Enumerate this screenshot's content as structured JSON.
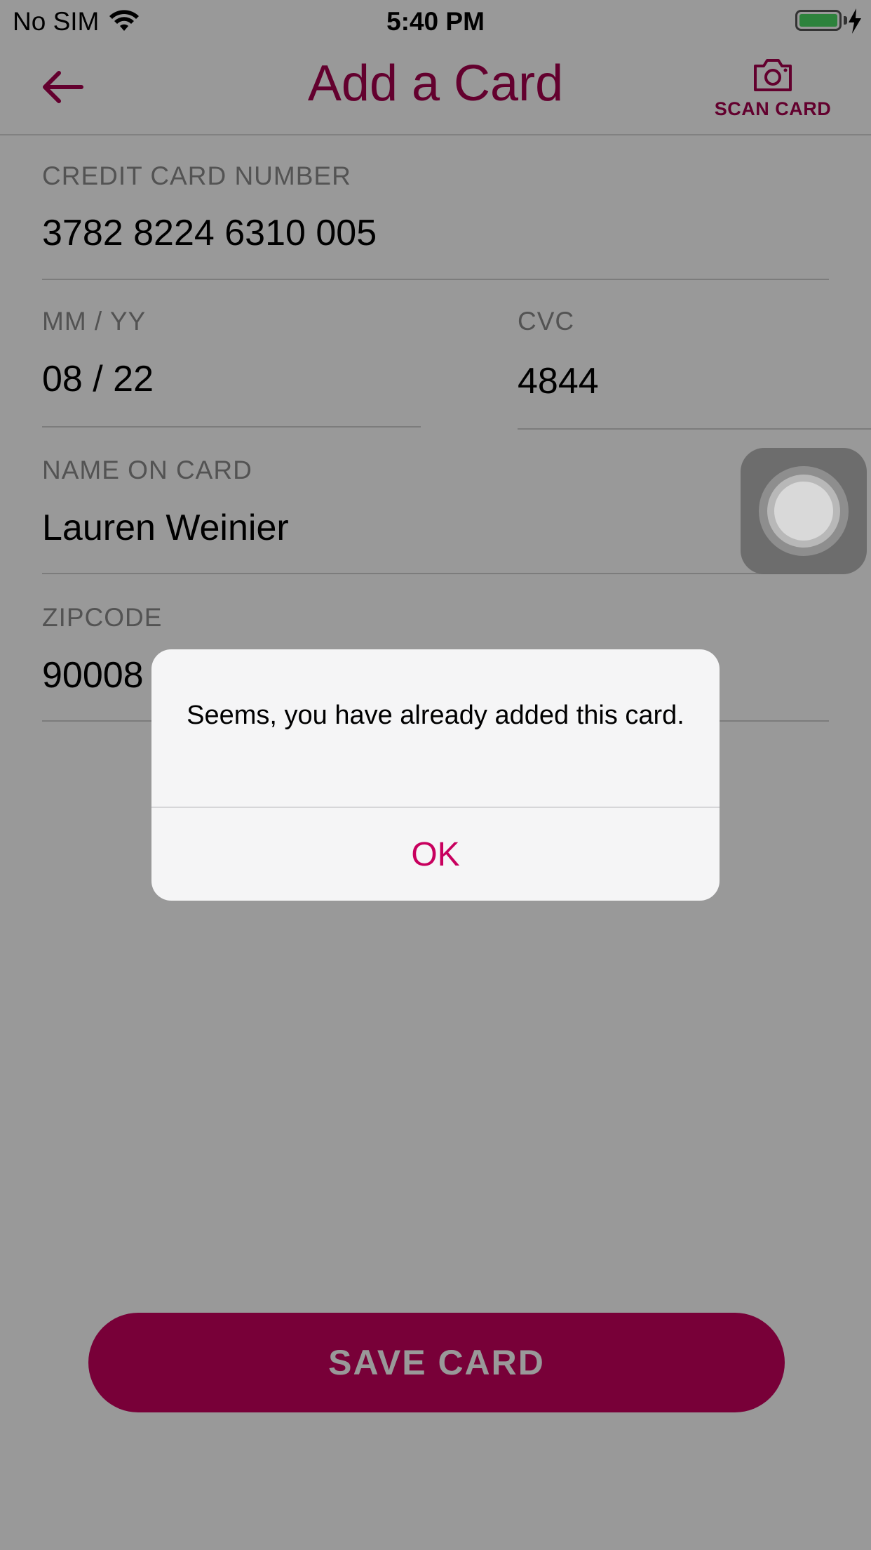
{
  "status_bar": {
    "carrier": "No SIM",
    "time": "5:40 PM"
  },
  "nav": {
    "title": "Add a Card",
    "scan_label": "SCAN CARD"
  },
  "form": {
    "card_number": {
      "label": "CREDIT CARD NUMBER",
      "value": "3782 8224 6310 005"
    },
    "expiry": {
      "label": "MM / YY",
      "value": "08 / 22"
    },
    "cvc": {
      "label": "CVC",
      "value": "4844"
    },
    "name": {
      "label": "NAME ON CARD",
      "value": "Lauren Weinier"
    },
    "zipcode": {
      "label": "ZIPCODE",
      "value": "90008"
    }
  },
  "save_button": {
    "label": "SAVE CARD"
  },
  "alert": {
    "message": "Seems, you have already added this card.",
    "ok_label": "OK"
  },
  "colors": {
    "accent": "#c8005e",
    "title": "#a5004d"
  }
}
